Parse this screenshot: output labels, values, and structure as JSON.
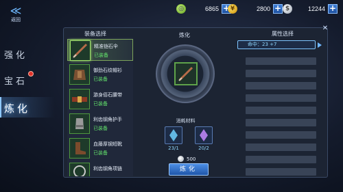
{
  "back": {
    "label": "返回",
    "icon": "back-chevron-icon"
  },
  "currencies": [
    {
      "name": "stamina",
      "value": "6865",
      "color": "#8bd43a",
      "icon": "stamina-icon"
    },
    {
      "name": "gold",
      "value": "2800",
      "color": "#f3c21c",
      "icon": "gold-coin-icon"
    },
    {
      "name": "silver",
      "value": "12244",
      "color": "#d5dbe4",
      "icon": "silver-coin-icon"
    }
  ],
  "tabs": [
    {
      "label": "强化",
      "active": false
    },
    {
      "label": "宝石",
      "active": false,
      "badge": true
    },
    {
      "label": "炼化",
      "active": true
    }
  ],
  "equip": {
    "title": "装备选择",
    "items": [
      {
        "name": "精准铠石伞",
        "status": "已装备"
      },
      {
        "name": "御劲石纹帽衫",
        "status": "已装备"
      },
      {
        "name": "游身佰石腰带",
        "status": "已装备"
      },
      {
        "name": "利齿钢角护手",
        "status": "已装备"
      },
      {
        "name": "血藤厚钢短靴",
        "status": "已装备"
      },
      {
        "name": "利齿钢角项链",
        "status": ""
      }
    ]
  },
  "refine": {
    "title": "炼化",
    "materials_title": "消耗材料",
    "materials": [
      {
        "count": "23/1",
        "color": "#6fd0ff",
        "icon": "sky-crystal-icon"
      },
      {
        "count": "20/2",
        "color": "#c58bff",
        "icon": "purple-crystal-icon"
      }
    ],
    "cost": "500",
    "button": "炼化"
  },
  "attr": {
    "title": "属性选择",
    "selected": "命中：23 +7",
    "colors": {
      "label": "#8fd7ff",
      "base": "#8fd7ff",
      "bonus": "#f5f5ff"
    }
  }
}
